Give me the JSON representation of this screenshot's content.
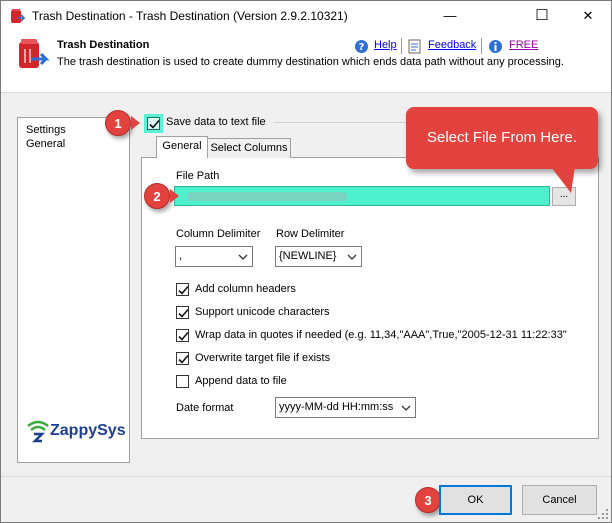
{
  "window": {
    "title": "Trash Destination - Trash Destination (Version 2.9.2.10321)",
    "minimize_glyph": "—",
    "maximize_glyph": "☐",
    "close_glyph": "✕"
  },
  "header": {
    "title": "Trash Destination",
    "description": "The trash destination is used to create dummy destination which ends data path without any processing.",
    "links": {
      "help": "Help",
      "feedback": "Feedback",
      "free": "FREE"
    }
  },
  "sidebar": {
    "items": [
      "Settings",
      "General"
    ],
    "logo_text": "ZappySys"
  },
  "save_to_file": {
    "label": "Save data to text file",
    "checked": true
  },
  "tabs": [
    {
      "label": "General",
      "active": true
    },
    {
      "label": "Select Columns",
      "active": false
    }
  ],
  "general": {
    "file_path_label": "File Path",
    "browse_label": "...",
    "column_delimiter_label": "Column Delimiter",
    "column_delimiter_value": ",",
    "row_delimiter_label": "Row Delimiter",
    "row_delimiter_value": "{NEWLINE}",
    "options": [
      {
        "label": "Add column headers",
        "checked": true
      },
      {
        "label": "Support unicode characters",
        "checked": true
      },
      {
        "label": "Wrap data in quotes if needed (e.g. 11,34,\"AAA\",True,\"2005-12-31 11:22:33\"",
        "checked": true
      },
      {
        "label": "Overwrite target file if exists",
        "checked": true
      },
      {
        "label": "Append data to file",
        "checked": false
      }
    ],
    "date_format_label": "Date format",
    "date_format_value": "yyyy-MM-dd HH:mm:ss"
  },
  "callouts": {
    "step1": "1",
    "step2": "2",
    "step3": "3",
    "bubble_text": "Select File From Here."
  },
  "buttons": {
    "ok": "OK",
    "cancel": "Cancel"
  },
  "colors": {
    "callout": "#e2433f",
    "highlight": "#4ef0ce",
    "link": "#0000ee",
    "free": "#9b00a8"
  }
}
